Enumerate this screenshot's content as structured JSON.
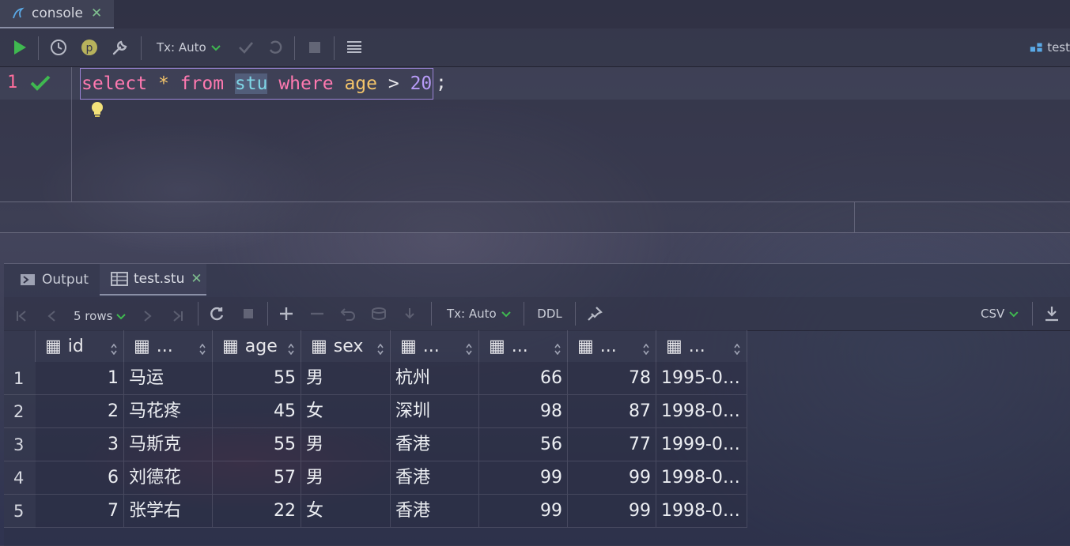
{
  "editor_tab": {
    "label": "console",
    "close": "✕"
  },
  "toolbar": {
    "tx_label": "Tx: Auto",
    "datasource": "test"
  },
  "editor": {
    "line_number": "1",
    "query": {
      "kw1": "select",
      "star": "*",
      "kw2": "from",
      "table": "stu",
      "kw3": "where",
      "column": "age",
      "op": ">",
      "number": "20",
      "end": ";"
    }
  },
  "results": {
    "tabs": [
      {
        "label": "Output"
      },
      {
        "label": "test.stu",
        "close": "✕"
      }
    ],
    "toolbar": {
      "rows_label": "5 rows",
      "tx_label": "Tx: Auto",
      "ddl_label": "DDL",
      "export_label": "CSV"
    },
    "columns": [
      "id",
      "...",
      "age",
      "sex",
      "...",
      "...",
      "...",
      "..."
    ],
    "rows": [
      {
        "num": "1",
        "cells": [
          "1",
          "马运",
          "55",
          "男",
          "杭州",
          "66",
          "78",
          "1995-0…"
        ]
      },
      {
        "num": "2",
        "cells": [
          "2",
          "马花疼",
          "45",
          "女",
          "深圳",
          "98",
          "87",
          "1998-0…"
        ]
      },
      {
        "num": "3",
        "cells": [
          "3",
          "马斯克",
          "55",
          "男",
          "香港",
          "56",
          "77",
          "1999-0…"
        ]
      },
      {
        "num": "4",
        "cells": [
          "6",
          "刘德花",
          "57",
          "男",
          "香港",
          "99",
          "99",
          "1998-0…"
        ]
      },
      {
        "num": "5",
        "cells": [
          "7",
          "张学右",
          "22",
          "女",
          "香港",
          "99",
          "99",
          "1998-0…"
        ]
      }
    ]
  },
  "colors": {
    "keyword": "#ff79b0",
    "operator": "#f5c56a",
    "identifier": "#7fd6e6",
    "number": "#b79bf7",
    "run_green": "#3fb950"
  }
}
